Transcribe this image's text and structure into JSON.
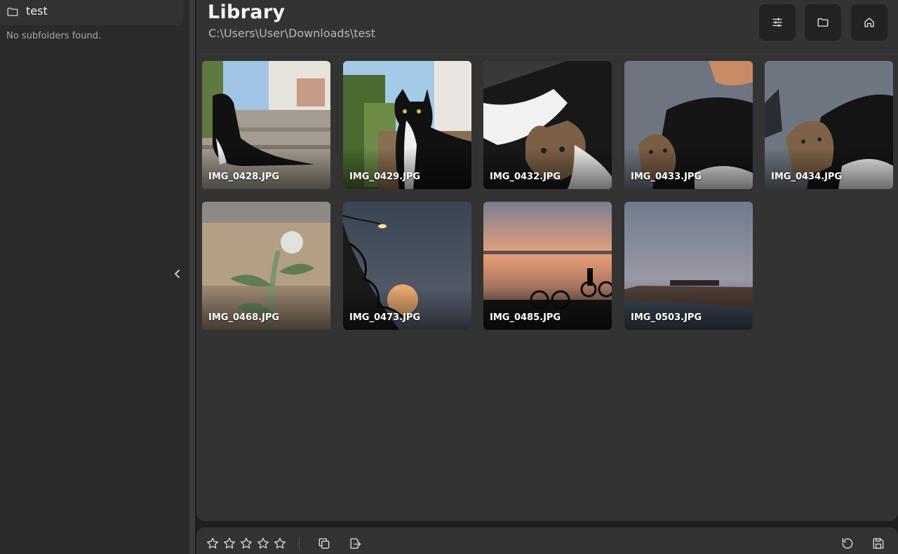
{
  "sidebar": {
    "folder_name": "test",
    "empty_message": "No subfolders found."
  },
  "header": {
    "title": "Library",
    "path": "C:\\Users\\User\\Downloads\\test"
  },
  "thumbnails": [
    {
      "name": "IMG_0428.JPG",
      "selected": false
    },
    {
      "name": "IMG_0429.JPG",
      "selected": false
    },
    {
      "name": "IMG_0432.JPG",
      "selected": true
    },
    {
      "name": "IMG_0433.JPG",
      "selected": false
    },
    {
      "name": "IMG_0434.JPG",
      "selected": false
    },
    {
      "name": "IMG_0468.JPG",
      "selected": false
    },
    {
      "name": "IMG_0473.JPG",
      "selected": false
    },
    {
      "name": "IMG_0485.JPG",
      "selected": false
    },
    {
      "name": "IMG_0503.JPG",
      "selected": false
    }
  ],
  "toolbar": {
    "rating": {
      "filled": 0,
      "max": 5
    }
  },
  "colors": {
    "background": "#1e1e1e",
    "sidebar": "#2a2a2a",
    "panel": "#333333",
    "button": "#222222",
    "text": "#f4f4f4",
    "muted": "#b8b8b8"
  }
}
